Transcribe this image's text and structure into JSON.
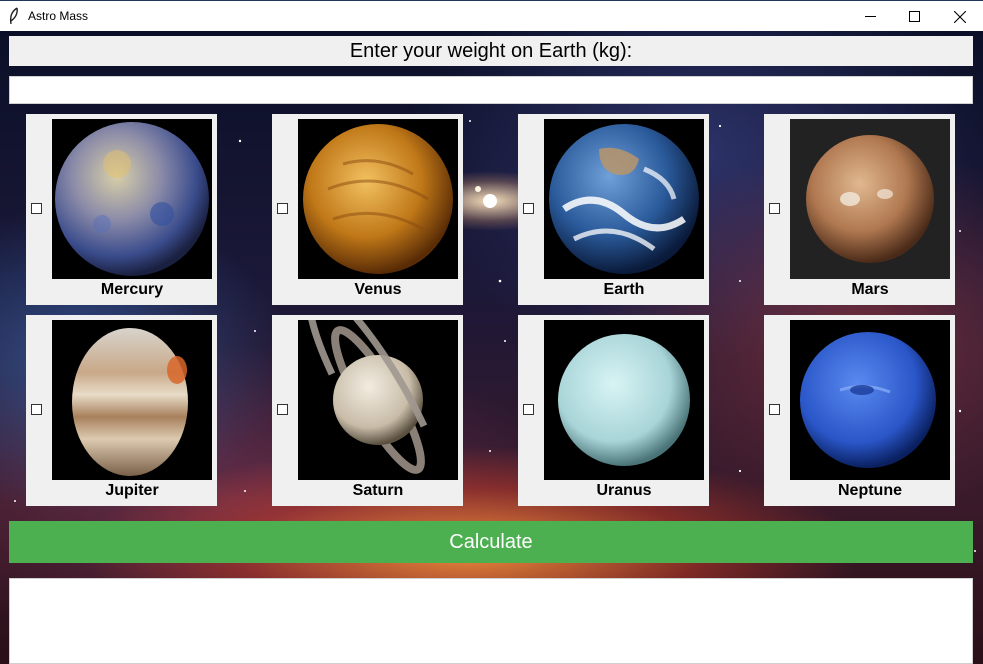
{
  "window": {
    "title": "Astro Mass"
  },
  "prompt": {
    "label": "Enter your weight on Earth (kg):"
  },
  "weight_input": {
    "value": "",
    "placeholder": ""
  },
  "planets": [
    {
      "name": "Mercury",
      "checked": false
    },
    {
      "name": "Venus",
      "checked": false
    },
    {
      "name": "Earth",
      "checked": false
    },
    {
      "name": "Mars",
      "checked": false
    },
    {
      "name": "Jupiter",
      "checked": false
    },
    {
      "name": "Saturn",
      "checked": false
    },
    {
      "name": "Uranus",
      "checked": false
    },
    {
      "name": "Neptune",
      "checked": false
    }
  ],
  "calculate": {
    "label": "Calculate",
    "color": "#4caf50"
  },
  "results": {
    "text": ""
  },
  "icons": {
    "app": "feather-icon",
    "minimize": "minimize-icon",
    "maximize": "maximize-icon",
    "close": "close-icon"
  }
}
